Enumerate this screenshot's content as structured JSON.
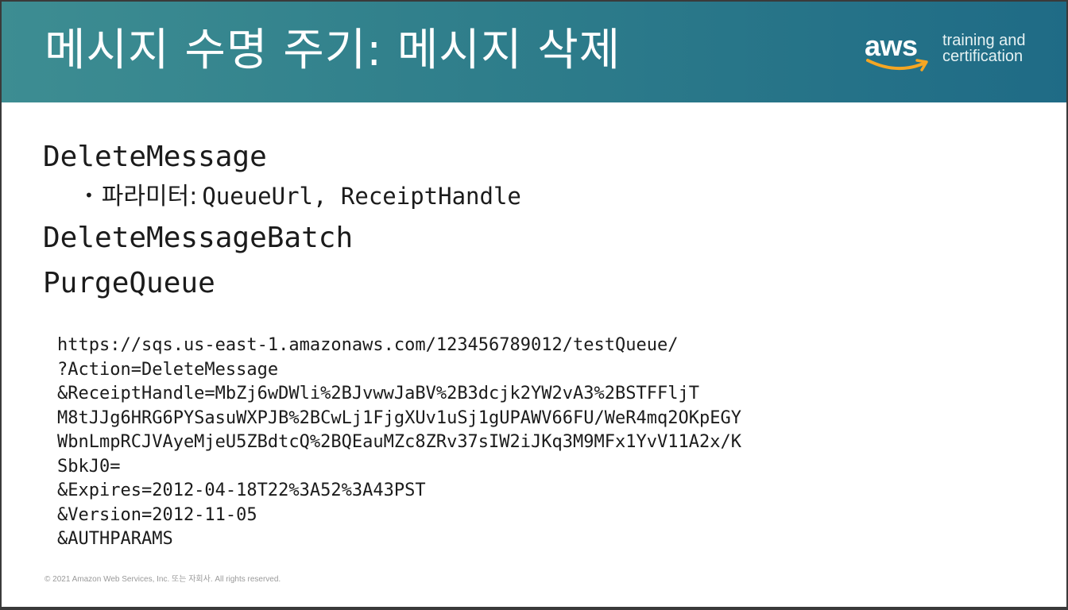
{
  "header": {
    "title": "메시지 수명 주기: 메시지 삭제",
    "logo": {
      "wordmark": "aws",
      "line1": "training and",
      "line2": "certification",
      "smile_color": "#f5a623"
    }
  },
  "content": {
    "items": [
      "DeleteMessage",
      "DeleteMessageBatch",
      "PurgeQueue"
    ],
    "bullet": {
      "label": "파라미터:",
      "values": "QueueUrl, ReceiptHandle"
    }
  },
  "code_lines": [
    "https://sqs.us-east-1.amazonaws.com/123456789012/testQueue/",
    "?Action=DeleteMessage",
    "&ReceiptHandle=MbZj6wDWli%2BJvwwJaBV%2B3dcjk2YW2vA3%2BSTFFljT",
    "M8tJJg6HRG6PYSasuWXPJB%2BCwLj1FjgXUv1uSj1gUPAWV66FU/WeR4mq2OKpEGY",
    "WbnLmpRCJVAyeMjeU5ZBdtcQ%2BQEauMZc8ZRv37sIW2iJKq3M9MFx1YvV11A2x/K",
    "SbkJ0=",
    "&Expires=2012-04-18T22%3A52%3A43PST",
    "&Version=2012-11-05",
    "&AUTHPARAMS"
  ],
  "footer": {
    "copyright": "© 2021 Amazon Web Services, Inc. 또는 자회사. All rights reserved."
  },
  "colors": {
    "header_start": "#3d8d92",
    "header_end": "#1f6b86",
    "text": "#1b1b1b"
  }
}
